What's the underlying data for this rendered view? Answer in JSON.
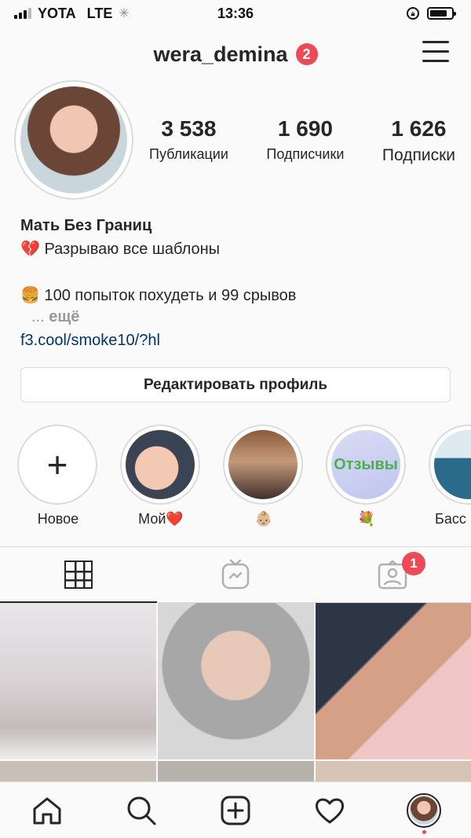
{
  "status_bar": {
    "carrier": "YOTA",
    "network": "LTE",
    "time": "13:36"
  },
  "header": {
    "username": "wera_demina",
    "notification_count": "2"
  },
  "profile": {
    "stats": [
      {
        "value": "3 538",
        "label": "Публикации"
      },
      {
        "value": "1 690",
        "label": "Подписчики"
      },
      {
        "value": "1 626",
        "label": "Подписки"
      }
    ],
    "bio": {
      "name": "Мать Без Границ",
      "line1_emoji": "💔",
      "line1": "Разрываю все шаблоны",
      "line2_emoji": "🍔",
      "line2": "100 попыток похудеть и 99 срывов",
      "more_prefix": "...",
      "more": "ещё",
      "link": "f3.cool/smoke10/?hl"
    },
    "edit_button": "Редактировать профиль"
  },
  "highlights": [
    {
      "label": "Новое",
      "icon": "plus-icon"
    },
    {
      "label": "Мой❤️"
    },
    {
      "label": "👶🏼"
    },
    {
      "label": "💐",
      "cover_text": "Отзывы"
    },
    {
      "label": "Басс"
    }
  ],
  "tabs": {
    "tagged_badge": "1",
    "items": [
      "grid-icon",
      "igtv-icon",
      "tagged-icon"
    ]
  },
  "colors": {
    "accent_badge": "#ed4956",
    "link": "#003569",
    "text": "#262626"
  }
}
